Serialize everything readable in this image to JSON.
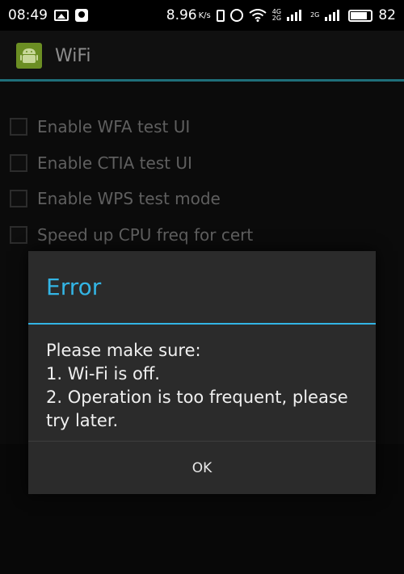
{
  "status_bar": {
    "time": "08:49",
    "net_speed": "8.96",
    "net_speed_unit": "K/s",
    "network_type_top": "4G",
    "network_type_bottom": "2G",
    "network_type_sim2": "2G",
    "battery": "82"
  },
  "action_bar": {
    "title": "WiFi",
    "icon": "android-icon"
  },
  "settings": {
    "items": [
      {
        "label": "Enable WFA test UI",
        "checked": false
      },
      {
        "label": "Enable CTIA test UI",
        "checked": false
      },
      {
        "label": "Enable WPS test mode",
        "checked": false
      },
      {
        "label": "Speed up CPU freq for cert",
        "checked": false
      }
    ]
  },
  "dialog": {
    "title": "Error",
    "message_lines": [
      "Please make sure:",
      "1. Wi-Fi is off.",
      "2. Operation is too frequent, please",
      "try later."
    ],
    "ok_label": "OK"
  },
  "colors": {
    "accent": "#33b5e5",
    "dialog_bg": "#2b2b2b",
    "app_icon": "#6b8e23"
  }
}
